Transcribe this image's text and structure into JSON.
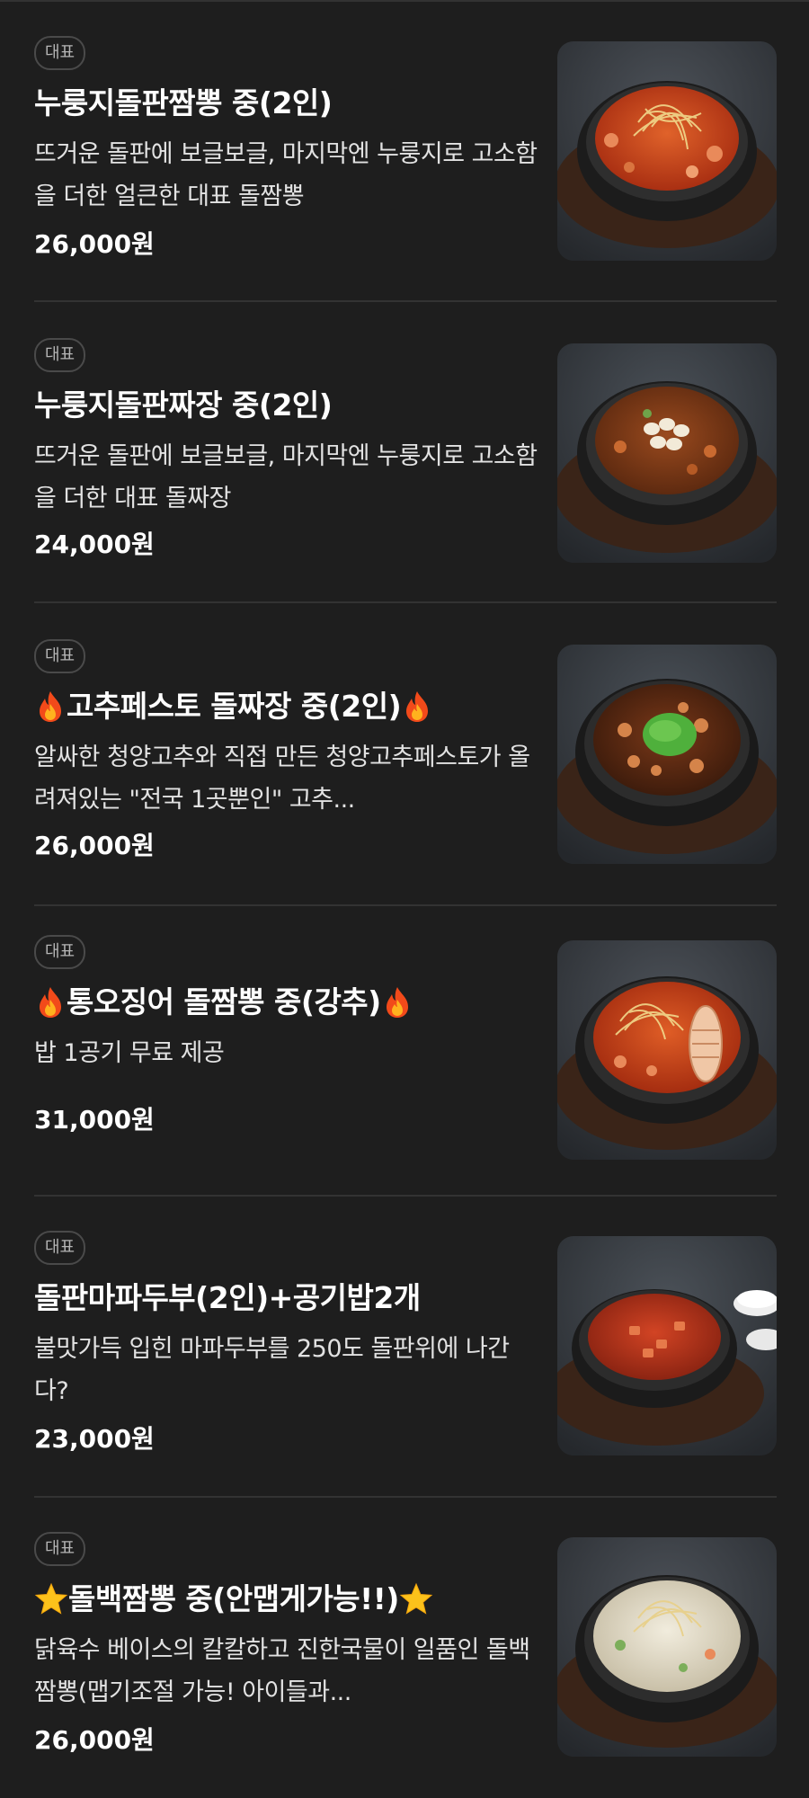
{
  "menu": {
    "items": [
      {
        "badge": "대표",
        "name": "누룽지돌판짬뽕 중(2인)",
        "name_prefix_icon": "",
        "name_suffix_icon": "",
        "description": "뜨거운 돌판에 보글보글, 마지막엔 누룽지로 고소함을 더한 얼큰한 대표 돌짬뽕",
        "price": "26,000원",
        "image": "jjamppong-stone-pot-photo",
        "broth_color": "#c9421c",
        "bg_color": "#3b3f45"
      },
      {
        "badge": "대표",
        "name": "누룽지돌판짜장 중(2인)",
        "name_prefix_icon": "",
        "name_suffix_icon": "",
        "description": "뜨거운 돌판에 보글보글, 마지막엔 누룽지로 고소함을 더한 대표 돌짜장",
        "price": "24,000원",
        "image": "jjajang-stone-pot-photo",
        "broth_color": "#7a3a16",
        "bg_color": "#3a3e44"
      },
      {
        "badge": "대표",
        "name": "고추페스토 돌짜장 중(2인)",
        "name_prefix_icon": "fire-icon",
        "name_suffix_icon": "fire-icon",
        "description": "알싸한 청양고추와 직접 만든 청양고추페스토가 올려져있는 \"전국 1곳뿐인\" 고추...",
        "price": "26,000원",
        "image": "pepper-pesto-jjajang-photo",
        "broth_color": "#5a2a12",
        "bg_color": "#3a3e44"
      },
      {
        "badge": "대표",
        "name": "통오징어 돌짬뽕 중(강추)",
        "name_prefix_icon": "fire-icon",
        "name_suffix_icon": "fire-icon",
        "description": "밥 1공기 무료 제공",
        "price": "31,000원",
        "image": "whole-squid-jjamppong-photo",
        "broth_color": "#c5401a",
        "bg_color": "#3b3f45"
      },
      {
        "badge": "대표",
        "name": "돌판마파두부(2인)+공기밥2개",
        "name_prefix_icon": "",
        "name_suffix_icon": "",
        "description": "불맛가득 입힌 마파두부를 250도 돌판위에 나간다?",
        "price": "23,000원",
        "image": "mapo-tofu-stone-pot-photo",
        "broth_color": "#b8311a",
        "bg_color": "#3a3e45"
      },
      {
        "badge": "대표",
        "name": "돌백짬뽕 중(안맵게가능!!)",
        "name_prefix_icon": "star-icon",
        "name_suffix_icon": "star-icon",
        "description": "닭육수 베이스의 칼칼하고 진한국물이 일품인 돌백짬뽕(맵기조절 가능! 아이들과...",
        "price": "26,000원",
        "image": "white-jjamppong-stone-pot-photo",
        "broth_color": "#ddd6c4",
        "bg_color": "#3b3f45"
      }
    ]
  },
  "colors": {
    "background": "#1e1e1e",
    "divider": "#333333",
    "badge_border": "#4a4a4a",
    "badge_text": "#b5b5b5",
    "text_primary": "#ffffff",
    "text_secondary": "#e2e2e2"
  }
}
